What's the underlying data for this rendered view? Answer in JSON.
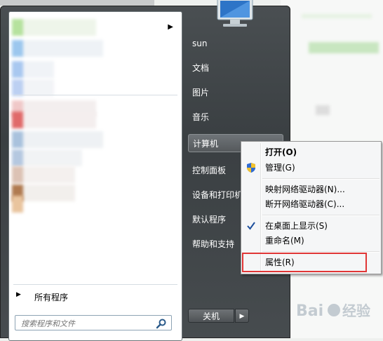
{
  "right_pane": {
    "items": [
      {
        "label": "sun"
      },
      {
        "label": "文档"
      },
      {
        "label": "图片"
      },
      {
        "label": "音乐"
      },
      {
        "label": "计算机"
      },
      {
        "label": "控制面板"
      },
      {
        "label": "设备和打印机"
      },
      {
        "label": "默认程序"
      },
      {
        "label": "帮助和支持"
      }
    ]
  },
  "left_pane": {
    "all_programs": "所有程序",
    "search_placeholder": "搜索程序和文件"
  },
  "shutdown": {
    "label": "关机"
  },
  "context_menu": {
    "items": [
      {
        "label": "打开(O)",
        "bold": true
      },
      {
        "label": "管理(G)",
        "icon": "shield-icon"
      },
      {
        "label": "映射网络驱动器(N)..."
      },
      {
        "label": "断开网络驱动器(C)..."
      },
      {
        "label": "在桌面上显示(S)",
        "checked": true
      },
      {
        "label": "重命名(M)"
      },
      {
        "label": "属性(R)"
      }
    ]
  },
  "watermark": {
    "text": "Bai du 经验"
  },
  "colors": {
    "highlight_border": "#e03636",
    "menu_dark": "#3a3f42"
  }
}
